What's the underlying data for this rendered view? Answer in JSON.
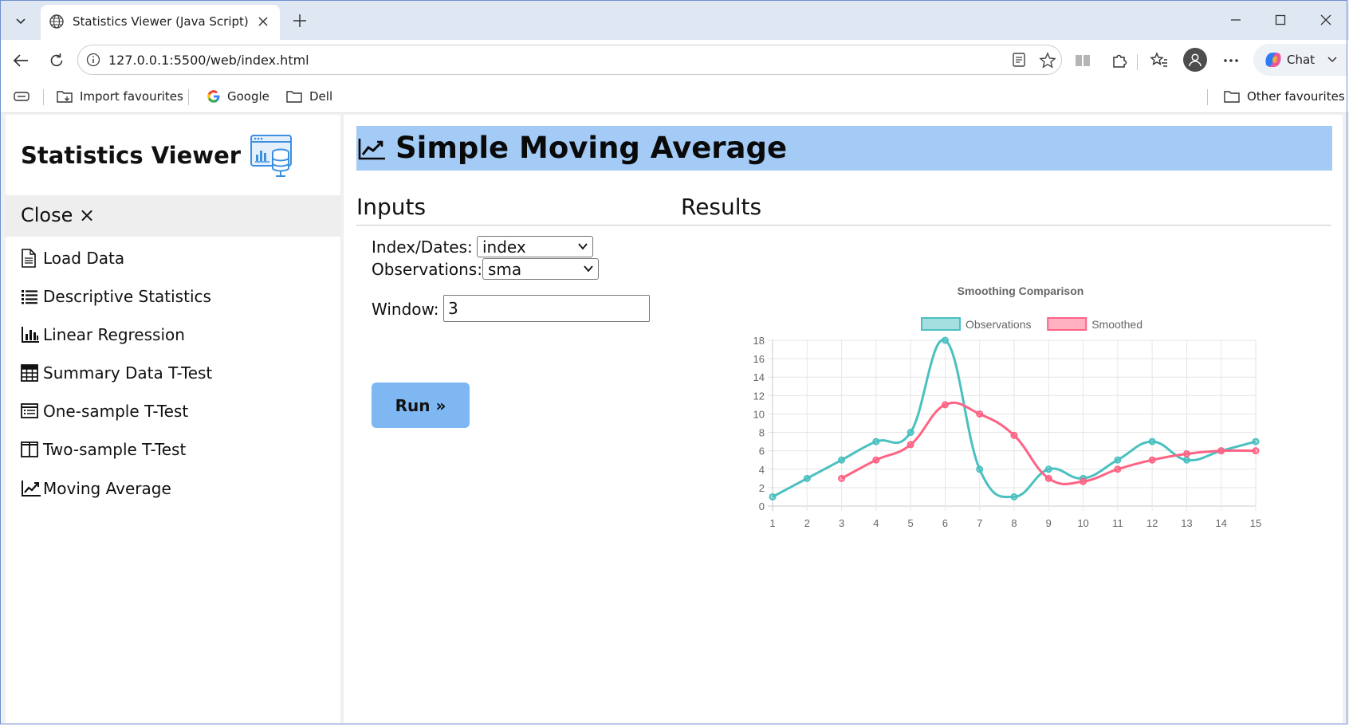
{
  "browser": {
    "tab_title": "Statistics Viewer (Java Script)",
    "url": "127.0.0.1:5500/web/index.html",
    "chat_label": "Chat",
    "bookmarks": [
      "Import favourites",
      "Google",
      "Dell"
    ],
    "other_favourites": "Other favourites"
  },
  "sidebar": {
    "title": "Statistics Viewer",
    "close_label": "Close ×",
    "items": [
      {
        "label": "Load Data",
        "icon": "file-icon"
      },
      {
        "label": "Descriptive Statistics",
        "icon": "list-icon"
      },
      {
        "label": "Linear Regression",
        "icon": "bar-chart-icon"
      },
      {
        "label": "Summary Data T-Test",
        "icon": "table-icon"
      },
      {
        "label": "One-sample T-Test",
        "icon": "list-box-icon"
      },
      {
        "label": "Two-sample T-Test",
        "icon": "columns-icon"
      },
      {
        "label": "Moving Average",
        "icon": "line-chart-icon"
      }
    ]
  },
  "main": {
    "header": "Simple Moving Average",
    "inputs_title": "Inputs",
    "results_title": "Results",
    "index_label": "Index/Dates:",
    "index_value": "index",
    "obs_label": "Observations:",
    "obs_value": "sma",
    "window_label": "Window:",
    "window_value": "3",
    "run_label": "Run »"
  },
  "colors": {
    "header_bg": "#a3cbf6",
    "run_bg": "#7eb7f2",
    "observations": "#4bc0c0",
    "smoothed": "#ff6384"
  },
  "chart_data": {
    "type": "line",
    "title": "Smoothing Comparison",
    "x": [
      1,
      2,
      3,
      4,
      5,
      6,
      7,
      8,
      9,
      10,
      11,
      12,
      13,
      14,
      15
    ],
    "series": [
      {
        "name": "Observations",
        "values": [
          1,
          3,
          5,
          7,
          8,
          18,
          4,
          1,
          4,
          3,
          5,
          7,
          5,
          6,
          7
        ]
      },
      {
        "name": "Smoothed",
        "values": [
          null,
          null,
          3,
          5,
          6.67,
          11,
          10,
          7.67,
          3,
          2.67,
          4,
          5,
          5.67,
          6,
          6
        ]
      }
    ],
    "ylim": [
      0,
      18
    ],
    "yticks": [
      0,
      2,
      4,
      6,
      8,
      10,
      12,
      14,
      16,
      18
    ],
    "grid": true,
    "legend": "top"
  }
}
